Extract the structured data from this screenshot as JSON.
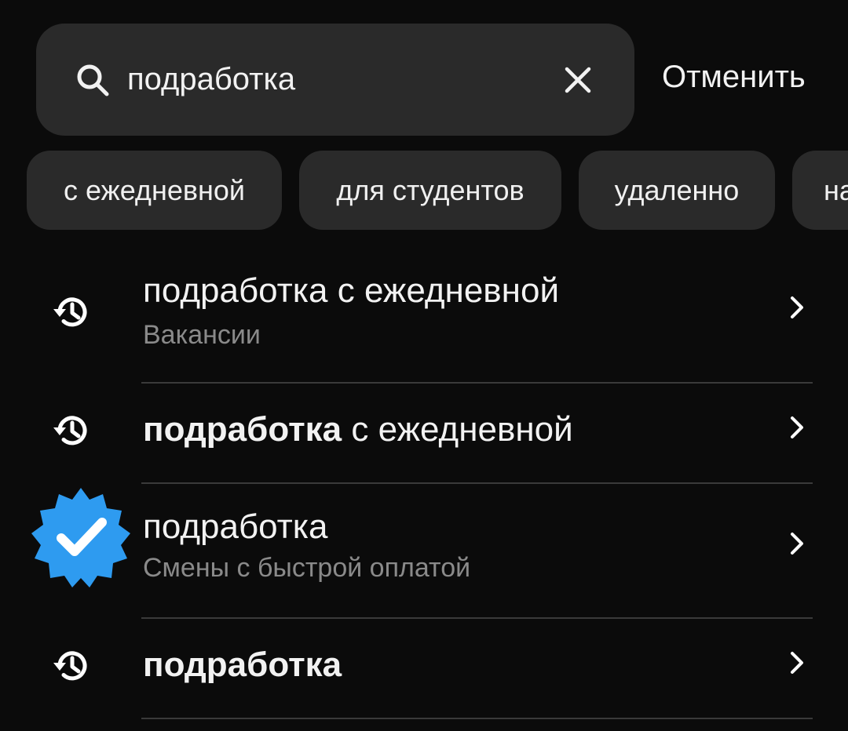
{
  "search": {
    "value": "подработка",
    "cancel_label": "Отменить"
  },
  "chips": [
    {
      "label": "с ежедневной"
    },
    {
      "label": "для студентов"
    },
    {
      "label": "удаленно"
    },
    {
      "label": "на"
    }
  ],
  "results": [
    {
      "icon": "history-icon",
      "title_bold": "",
      "title": "подработка с ежедневной",
      "subtitle": "Вакансии"
    },
    {
      "icon": "history-icon",
      "title_bold": "подработка",
      "title": " с ежедневной",
      "subtitle": ""
    },
    {
      "icon": "verified-badge-icon",
      "title_bold": "",
      "title": "подработка",
      "subtitle": "Смены с быстрой оплатой"
    },
    {
      "icon": "history-icon",
      "title_bold": "подработка",
      "title": "",
      "subtitle": ""
    }
  ],
  "colors": {
    "background": "#0b0b0b",
    "surface": "#2a2a2a",
    "badge": "#2e9bf0"
  }
}
